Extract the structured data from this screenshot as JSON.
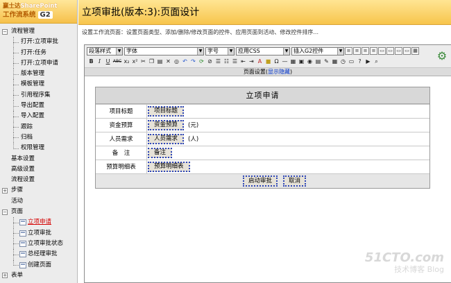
{
  "logo": {
    "line1_cn": "赢士达",
    "line1_en": "SharePoint",
    "line2": "工作流系统",
    "badge": "G2"
  },
  "page": {
    "title": "立项审批(版本:3):页面设计",
    "description": "设置工作流页面：设置页面类型、添加/删除/修改页面的控件、应用页面到活动、修改控件排序..."
  },
  "sidebar": {
    "flow_mgmt": "流程管理",
    "open_project": "打开:立项审批",
    "open_task": "打开:任务",
    "open_request": "打开:立项申请",
    "version_mgmt": "版本管理",
    "template_mgmt": "模板管理",
    "ref_assemblies": "引用程序集",
    "export_config": "导出配置",
    "import_config": "导入配置",
    "trace": "跟踪",
    "archive": "归档",
    "permission": "权限管理",
    "basic_settings": "基本设置",
    "advanced_settings": "高级设置",
    "flow_settings": "流程设置",
    "steps": "步骤",
    "activities": "活动",
    "pages": "页面",
    "page1": "立项申请",
    "page2": "立项审批",
    "page3": "立项审批状态",
    "page4": "总经理审批",
    "create_page": "创建页面",
    "forms": "表单"
  },
  "toolbar": {
    "paragraph_style": "段落样式",
    "font": "字体",
    "font_size": "字号",
    "apply_css": "应用CSS",
    "insert_control": "插入G2控件",
    "b": "B",
    "i": "I",
    "u": "U",
    "abc": "ABC",
    "sub": "x₂",
    "sup": "x²",
    "icons": [
      "cut-icon",
      "copy-icon",
      "paste-icon",
      "delete-icon",
      "find-icon",
      "undo-icon",
      "redo-icon",
      "refresh-icon",
      "link-icon",
      "unlink-icon",
      "ordered-list-icon",
      "unordered-list-icon",
      "outdent-icon",
      "indent-icon",
      "text-color-icon",
      "bg-color-icon",
      "symbol-icon",
      "table-icon",
      "hr-icon",
      "image-icon",
      "flash-icon",
      "media-icon",
      "special-char-icon",
      "date-icon",
      "time-icon",
      "form-icon",
      "help-icon",
      "preview-icon",
      "zoom-icon"
    ]
  },
  "page_settings": {
    "label": "页面设置",
    "link": "显示隐藏"
  },
  "form": {
    "title": "立项申请",
    "rows": [
      {
        "label": "项目标题",
        "field": "项目标题",
        "unit": ""
      },
      {
        "label": "资金预算",
        "field": "资金预算",
        "unit": "(元)"
      },
      {
        "label": "人员需求",
        "field": "人员需求",
        "unit": "(人)"
      },
      {
        "label": "备　注",
        "field": "备注",
        "unit": ""
      },
      {
        "label": "预算明细表",
        "field": "预算明细表",
        "unit": ""
      }
    ],
    "submit": "启动审批",
    "cancel": "取消"
  },
  "watermark": {
    "site": "51CTO.com",
    "sub": "技术博客",
    "blog": "Blog"
  },
  "colors": {
    "header": "#f7c54c",
    "link_red": "#d40000",
    "field_border": "#2b44b8"
  }
}
